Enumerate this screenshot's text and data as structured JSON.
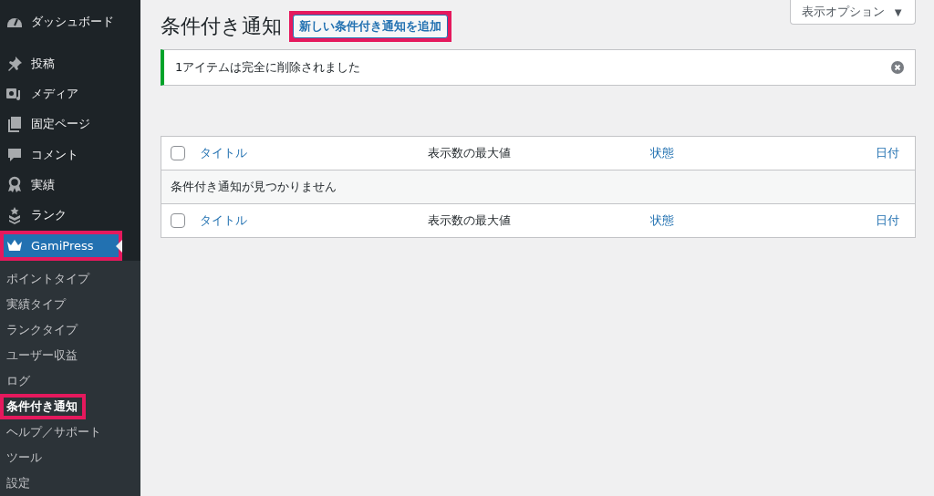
{
  "sidebar": {
    "items": [
      {
        "label": "ダッシュボード",
        "selected": false
      },
      {
        "label": "投稿",
        "selected": false
      },
      {
        "label": "メディア",
        "selected": false
      },
      {
        "label": "固定ページ",
        "selected": false
      },
      {
        "label": "コメント",
        "selected": false
      },
      {
        "label": "実績",
        "selected": false
      },
      {
        "label": "ランク",
        "selected": false
      },
      {
        "label": "GamiPress",
        "selected": true,
        "highlighted": true
      }
    ],
    "submenu": [
      {
        "label": "ポイントタイプ",
        "selected": false,
        "highlighted": false
      },
      {
        "label": "実績タイプ",
        "selected": false,
        "highlighted": false
      },
      {
        "label": "ランクタイプ",
        "selected": false,
        "highlighted": false
      },
      {
        "label": "ユーザー収益",
        "selected": false,
        "highlighted": false
      },
      {
        "label": "ログ",
        "selected": false,
        "highlighted": false
      },
      {
        "label": "条件付き通知",
        "selected": true,
        "highlighted": true
      },
      {
        "label": "ヘルプ／サポート",
        "selected": false,
        "highlighted": false
      },
      {
        "label": "ツール",
        "selected": false,
        "highlighted": false
      },
      {
        "label": "設定",
        "selected": false,
        "highlighted": false
      }
    ]
  },
  "screen_options": {
    "label": "表示オプション",
    "caret": "▼"
  },
  "page": {
    "title": "条件付き通知",
    "add_button": {
      "label": "新しい条件付き通知を追加",
      "highlighted": true
    }
  },
  "notice": {
    "text": "1アイテムは完全に削除されました"
  },
  "table": {
    "header": {
      "checked": false,
      "columns": [
        {
          "label": "タイトル",
          "sortable": true
        },
        {
          "label": "表示数の最大値",
          "sortable": false
        },
        {
          "label": "状態",
          "sortable": true
        },
        {
          "label": "日付",
          "sortable": true
        }
      ]
    },
    "empty_message": "条件付き通知が見つかりません",
    "footer": {
      "checked": false,
      "columns": [
        {
          "label": "タイトル",
          "sortable": true
        },
        {
          "label": "表示数の最大値",
          "sortable": false
        },
        {
          "label": "状態",
          "sortable": true
        },
        {
          "label": "日付",
          "sortable": true
        }
      ]
    }
  }
}
